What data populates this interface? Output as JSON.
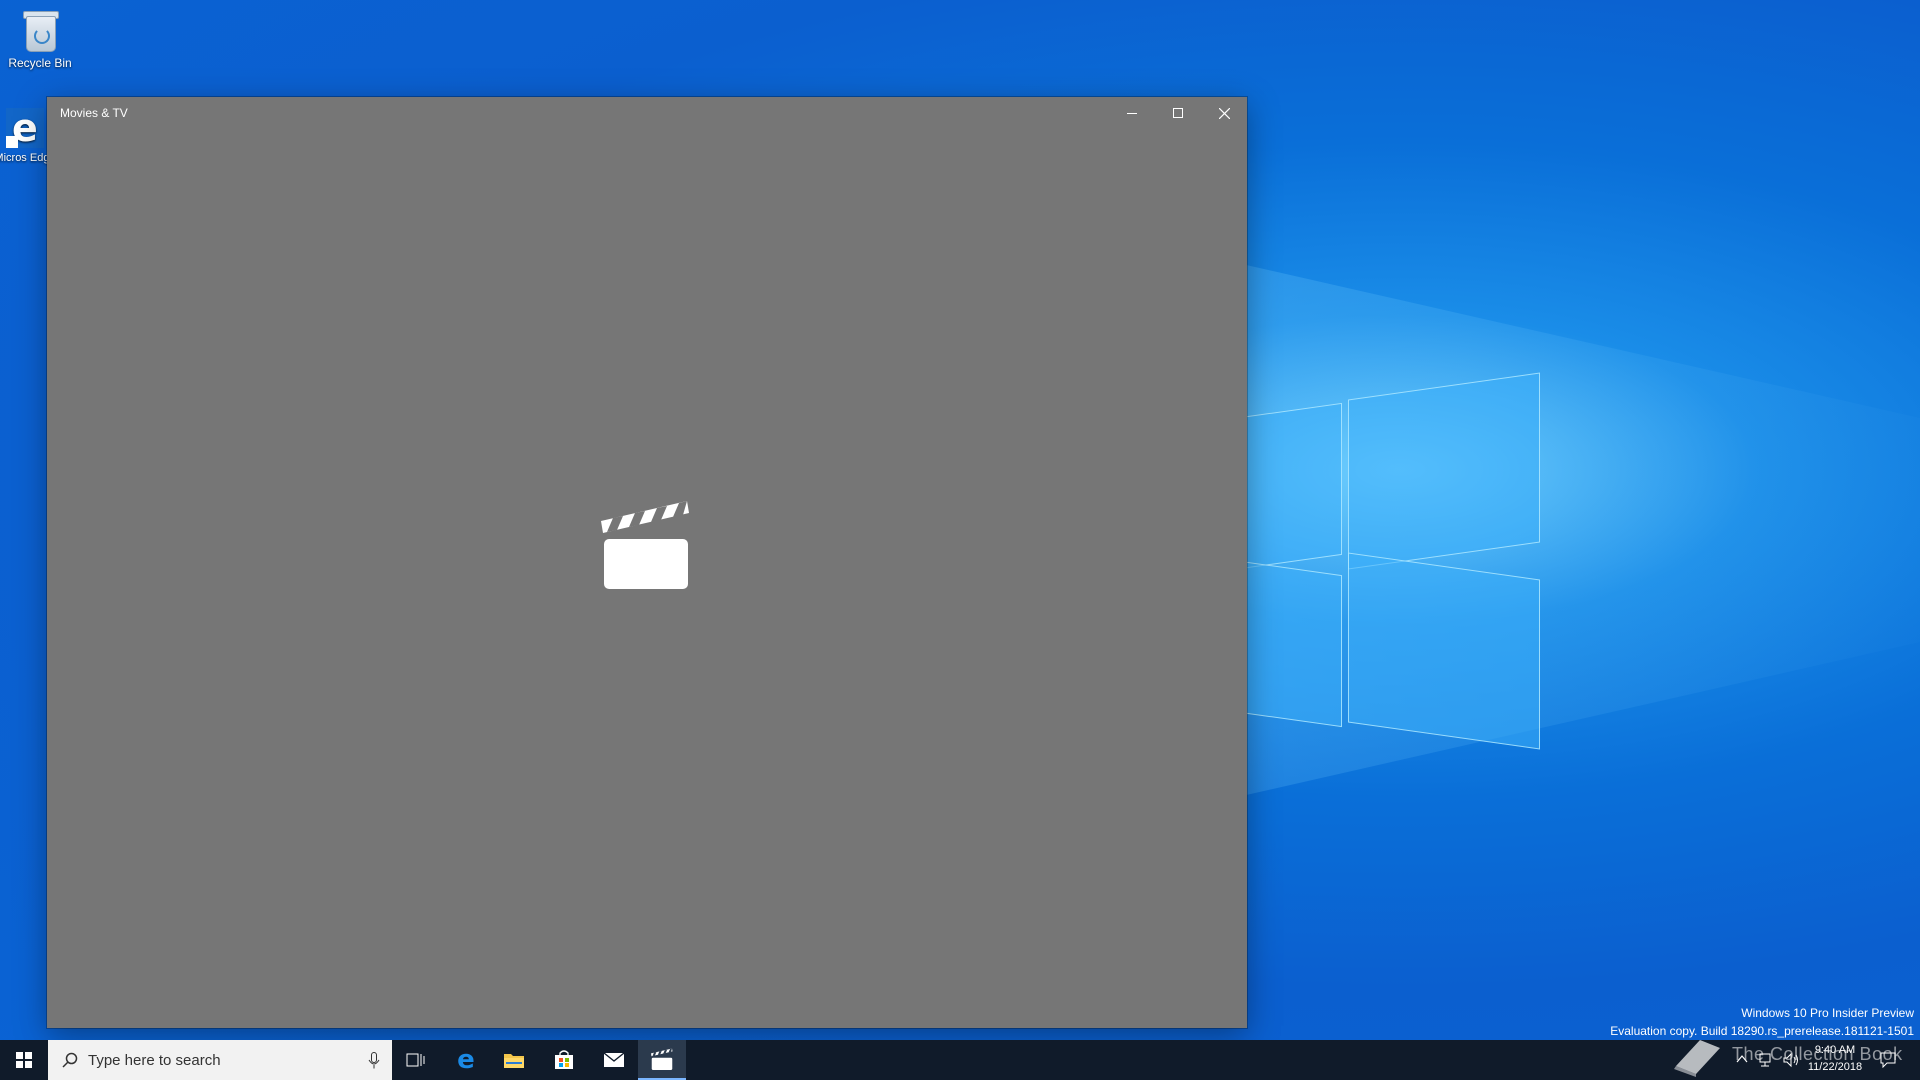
{
  "desktop": {
    "icons": [
      {
        "label": "Recycle Bin"
      },
      {
        "label": "Micros Edge"
      }
    ],
    "watermark": {
      "line1": "Windows 10 Pro Insider Preview",
      "line2": "Evaluation copy. Build 18290.rs_prerelease.181121-1501"
    },
    "overlay_brand": "The Collection Book"
  },
  "window": {
    "title": "Movies & TV",
    "background_color": "#767676",
    "splash_icon": "clapperboard-icon",
    "controls": [
      "minimize-icon",
      "maximize-icon",
      "close-icon"
    ]
  },
  "taskbar": {
    "search_placeholder": "Type here to search",
    "pinned": [
      "start-icon",
      "task-view-icon",
      "edge-icon",
      "file-explorer-icon",
      "store-icon",
      "mail-icon",
      "movies-tv-icon"
    ],
    "active_app": "movies-tv-icon",
    "clock": {
      "time": "9:40 AM",
      "date": "11/22/2018"
    }
  }
}
